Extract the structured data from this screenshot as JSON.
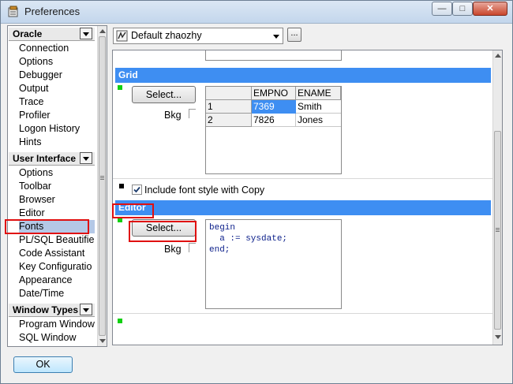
{
  "window": {
    "title": "Preferences",
    "min_label": "—",
    "max_label": "□",
    "close_label": "✕"
  },
  "sidebar": {
    "groups": [
      {
        "label": "Oracle",
        "items": [
          "Connection",
          "Options",
          "Debugger",
          "Output",
          "Trace",
          "Profiler",
          "Logon History",
          "Hints"
        ]
      },
      {
        "label": "User Interface",
        "items": [
          "Options",
          "Toolbar",
          "Browser",
          "Editor",
          "Fonts",
          "PL/SQL Beautifie",
          "Code Assistant",
          "Key Configuratio",
          "Appearance",
          "Date/Time"
        ]
      },
      {
        "label": "Window Types",
        "items": [
          "Program Window",
          "SQL Window"
        ]
      }
    ],
    "selected": "Fonts"
  },
  "profile": {
    "value": "Default zhaozhy",
    "dots_label": "..."
  },
  "grid_section": {
    "title": "Grid",
    "select_label": "Select...",
    "bkg_label": "Bkg",
    "columns": [
      "EMPNO",
      "ENAME"
    ],
    "rows": [
      {
        "num": "1",
        "empno": "7369",
        "ename": "Smith"
      },
      {
        "num": "2",
        "empno": "7826",
        "ename": "Jones"
      }
    ]
  },
  "include_font_style": {
    "label": "Include font style with Copy",
    "checked": true
  },
  "editor_section": {
    "title": "Editor",
    "select_label": "Select...",
    "bkg_label": "Bkg",
    "code_lines": [
      "begin",
      "  a := sysdate;",
      "end;"
    ]
  },
  "ok_label": "OK",
  "colors": {
    "section_bar": "#3e8ef2",
    "selected_item": "#b4c8e6",
    "indicator_green": "#10d010",
    "highlight_box": "#e01010"
  }
}
